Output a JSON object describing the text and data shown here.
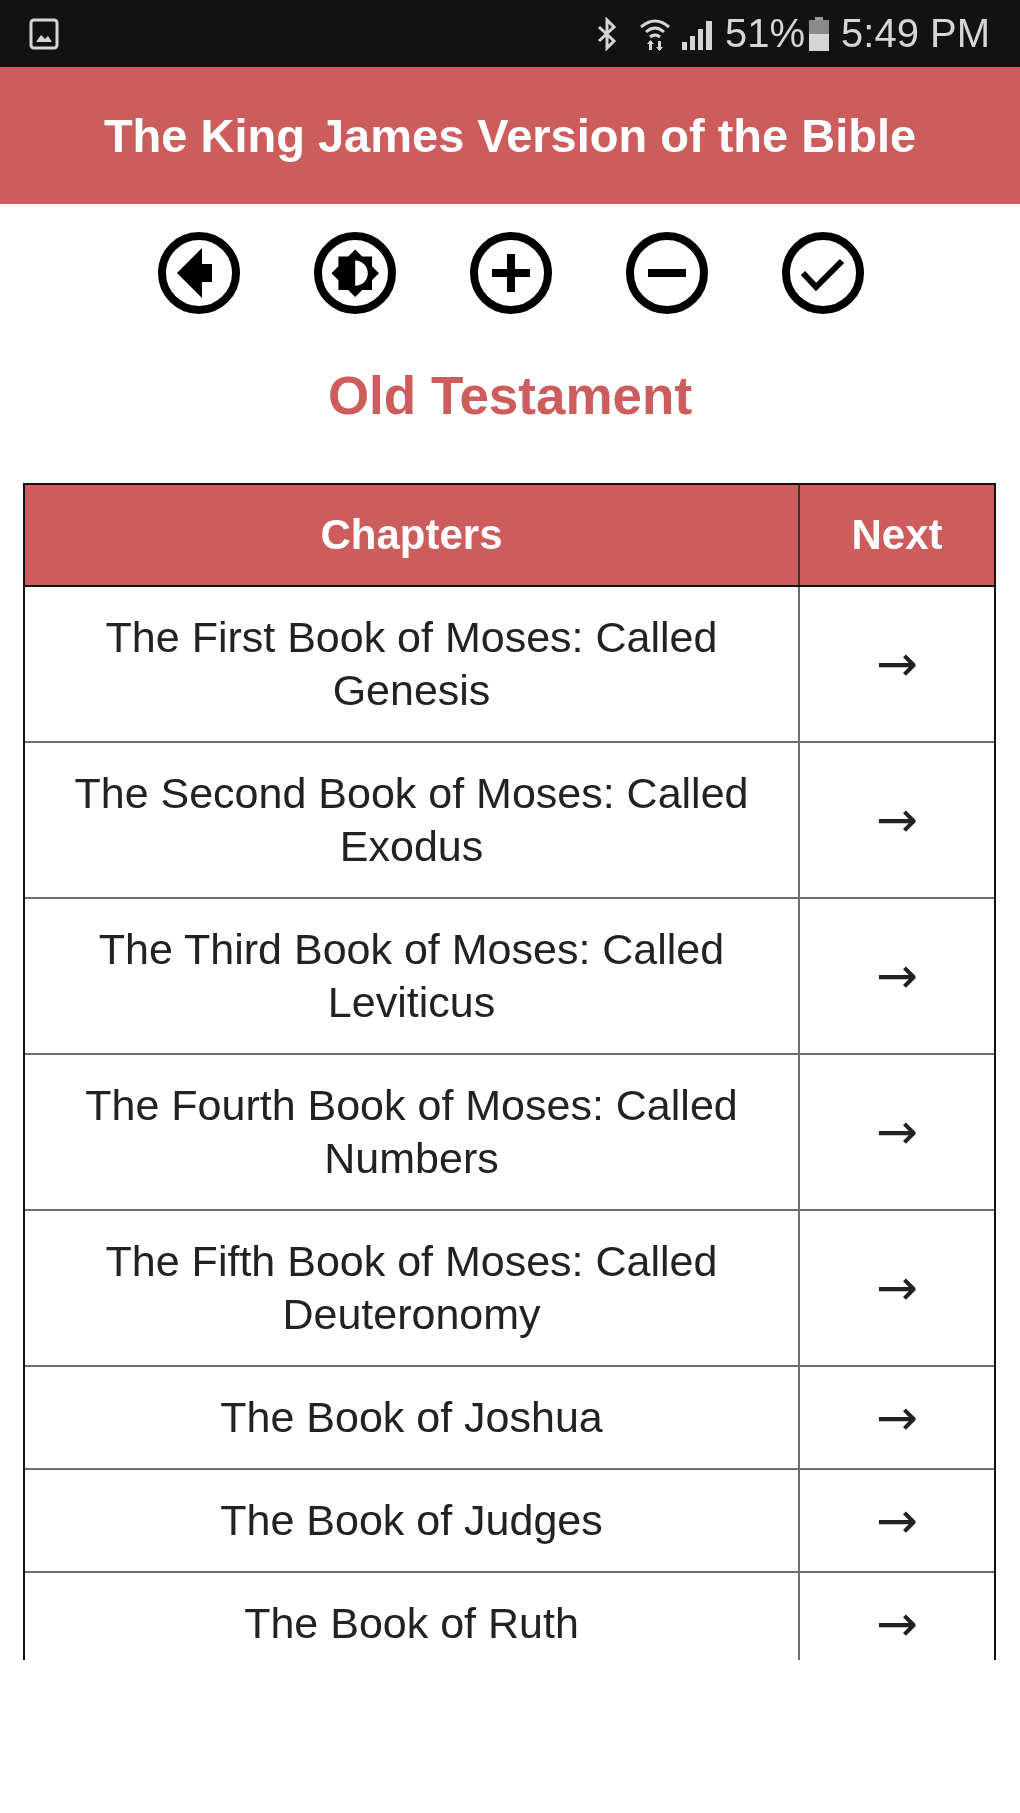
{
  "status_bar": {
    "battery_text": "51%",
    "time": "5:49 PM"
  },
  "app_bar": {
    "title": "The King James Version of the Bible"
  },
  "section_title": "Old Testament",
  "table": {
    "columns": [
      "Chapters",
      "Next"
    ],
    "rows": [
      {
        "title": "The First Book of Moses: Called Genesis",
        "next": "→"
      },
      {
        "title": "The Second Book of Moses: Called Exodus",
        "next": "→"
      },
      {
        "title": "The Third Book of Moses: Called Leviticus",
        "next": "→"
      },
      {
        "title": "The Fourth Book of Moses: Called Numbers",
        "next": "→"
      },
      {
        "title": "The Fifth Book of Moses: Called Deuteronomy",
        "next": "→"
      },
      {
        "title": "The Book of Joshua",
        "next": "→"
      },
      {
        "title": "The Book of Judges",
        "next": "→"
      },
      {
        "title": "The Book of Ruth",
        "next": "→"
      }
    ]
  }
}
